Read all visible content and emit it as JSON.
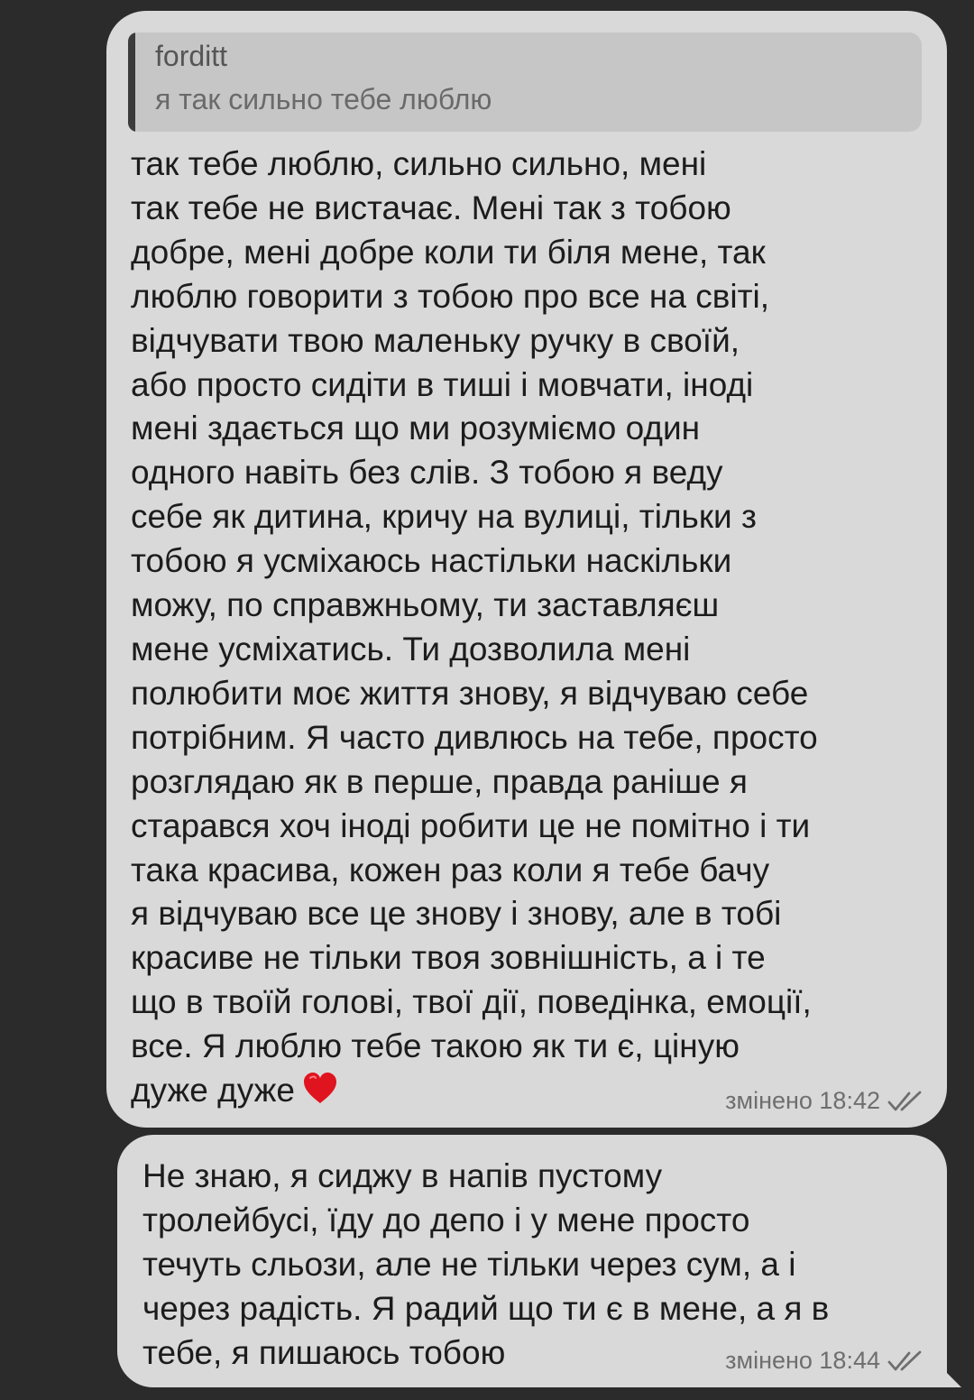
{
  "messages": [
    {
      "reply": {
        "author": "forditt",
        "text": "я так сильно тебе люблю"
      },
      "lines": [
        "так тебе люблю, сильно сильно, мені",
        "так тебе не вистачає. Мені так з тобою",
        "добре, мені добре коли ти біля мене, так",
        "люблю говорити з тобою про все на світі,",
        "відчувати твою маленьку ручку в своїй,",
        "або просто сидіти в тиші і мовчати, іноді",
        "мені здається що ми розуміємо один",
        "одного навіть без слів. З тобою я веду",
        "себе як дитина, кричу на вулиці, тільки з",
        "тобою я усміхаюсь настільки наскільки",
        "можу, по справжньому, ти заставляєш",
        "мене усміхатись. Ти дозволила мені",
        "полюбити моє життя знову, я відчуваю себе",
        "потрібним. Я часто дивлюсь на тебе, просто",
        "розглядаю як в перше, правда раніше я",
        "старався хоч іноді робити це не помітно і ти",
        "така красива, кожен раз коли я тебе бачу",
        "я відчуваю все це знову і знову, але в тобі",
        "красиве не тільки твоя зовнішність, а і те",
        "що в твоїй голові, твої дії, поведінка, емоції,",
        "все. Я люблю тебе такою як ти є, ціную",
        "дуже дуже"
      ],
      "emoji": "red-heart",
      "meta": "змінено 18:42",
      "status_icon": "double-check-icon"
    },
    {
      "lines": [
        "Не знаю, я сиджу в напів пустому",
        "тролейбусі, їду до депо і у мене просто",
        "течуть сльози, але не тільки через сум, а і",
        "через радість. Я радий що ти є в мене, а я в",
        "тебе, я пишаюсь тобою"
      ],
      "meta": "змінено 18:44",
      "status_icon": "double-check-icon"
    }
  ],
  "colors": {
    "background": "#2b2b2b",
    "bubble": "#d9d9d9",
    "reply_bg": "#c6c6c6",
    "reply_bar": "#3b3b3b",
    "text": "#1c1c1c",
    "heart": "#e0141e"
  }
}
